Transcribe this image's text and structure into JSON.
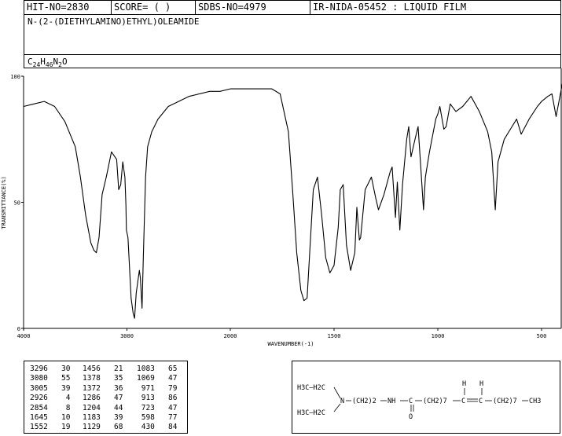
{
  "header": {
    "hit_no": "HIT-NO=2830",
    "score": "SCORE=  (   )",
    "sdbs_no": "SDBS-NO=4979",
    "sample": "IR-NIDA-05452 : LIQUID FILM",
    "compound_name": "N-(2-(DIETHYLAMINO)ETHYL)OLEAMIDE",
    "formula": {
      "c": "C",
      "c_n": "24",
      "h": "H",
      "h_n": "46",
      "n": "N",
      "n_n": "2",
      "o": "O"
    }
  },
  "chart_data": {
    "type": "line",
    "title": "",
    "xlabel": "WAVENUMBER(-1)",
    "ylabel": "TRANSMITTANCE(%)",
    "xlim": [
      4000,
      400
    ],
    "ylim": [
      0,
      100
    ],
    "x_ticks": [
      "4000",
      "3000",
      "2000",
      "1500",
      "1000",
      "500"
    ],
    "y_ticks": [
      "100",
      "50",
      "0"
    ],
    "grid": false,
    "line_color": "#000000",
    "series": [
      {
        "x": [
          4000,
          3900,
          3800,
          3700,
          3600,
          3500,
          3450,
          3400,
          3350,
          3320,
          3296,
          3270,
          3240,
          3200,
          3150,
          3100,
          3080,
          3060,
          3040,
          3020,
          3010,
          3005,
          2990,
          2960,
          2940,
          2926,
          2910,
          2880,
          2870,
          2854,
          2840,
          2820,
          2800,
          2760,
          2700,
          2600,
          2500,
          2400,
          2300,
          2200,
          2100,
          2000,
          1900,
          1800,
          1760,
          1720,
          1700,
          1680,
          1660,
          1645,
          1630,
          1600,
          1580,
          1560,
          1540,
          1520,
          1500,
          1480,
          1470,
          1456,
          1440,
          1420,
          1400,
          1390,
          1378,
          1372,
          1350,
          1320,
          1300,
          1286,
          1260,
          1230,
          1220,
          1204,
          1195,
          1183,
          1170,
          1150,
          1140,
          1129,
          1110,
          1095,
          1083,
          1069,
          1060,
          1040,
          1010,
          1000,
          990,
          971,
          960,
          940,
          913,
          880,
          840,
          800,
          760,
          740,
          723,
          710,
          680,
          650,
          620,
          598,
          560,
          520,
          500,
          470,
          450,
          430,
          400
        ],
        "y": [
          88,
          89,
          90,
          88,
          82,
          72,
          60,
          45,
          34,
          31,
          30,
          36,
          53,
          60,
          70,
          67,
          55,
          57,
          66,
          60,
          49,
          39,
          36,
          12,
          6,
          4,
          14,
          23,
          20,
          8,
          30,
          60,
          72,
          78,
          83,
          88,
          90,
          92,
          93,
          94,
          94,
          95,
          95,
          95,
          93,
          78,
          55,
          30,
          15,
          11,
          12,
          55,
          60,
          45,
          28,
          22,
          25,
          40,
          55,
          57,
          33,
          23,
          30,
          48,
          35,
          36,
          55,
          60,
          52,
          47,
          53,
          62,
          64,
          44,
          58,
          39,
          57,
          75,
          80,
          68,
          75,
          80,
          65,
          47,
          60,
          70,
          83,
          85,
          88,
          79,
          80,
          89,
          86,
          88,
          92,
          86,
          78,
          70,
          47,
          66,
          75,
          79,
          83,
          77,
          83,
          88,
          90,
          92,
          93,
          84,
          97
        ]
      }
    ],
    "peak_table": [
      [
        "3296",
        "30"
      ],
      [
        "3080",
        "55"
      ],
      [
        "3005",
        "39"
      ],
      [
        "2926",
        "4"
      ],
      [
        "2854",
        "8"
      ],
      [
        "1645",
        "10"
      ],
      [
        "1552",
        "19"
      ],
      [
        "1456",
        "21"
      ],
      [
        "1378",
        "35"
      ],
      [
        "1372",
        "36"
      ],
      [
        "1286",
        "47"
      ],
      [
        "1204",
        "44"
      ],
      [
        "1183",
        "39"
      ],
      [
        "1129",
        "68"
      ],
      [
        "1083",
        "65"
      ],
      [
        "1069",
        "47"
      ],
      [
        "971",
        "79"
      ],
      [
        "913",
        "86"
      ],
      [
        "723",
        "47"
      ],
      [
        "598",
        "77"
      ],
      [
        "430",
        "84"
      ]
    ]
  },
  "structure": {
    "r1": "H3C—H2C",
    "r2": "H3C—H2C",
    "n": "N",
    "chain1": "(CH2)2",
    "nh": "NH",
    "c": "C",
    "o": "O",
    "chain2": "(CH2)7",
    "h1": "H",
    "h2": "H",
    "chain3": "(CH2)7",
    "ch3": "CH3"
  }
}
